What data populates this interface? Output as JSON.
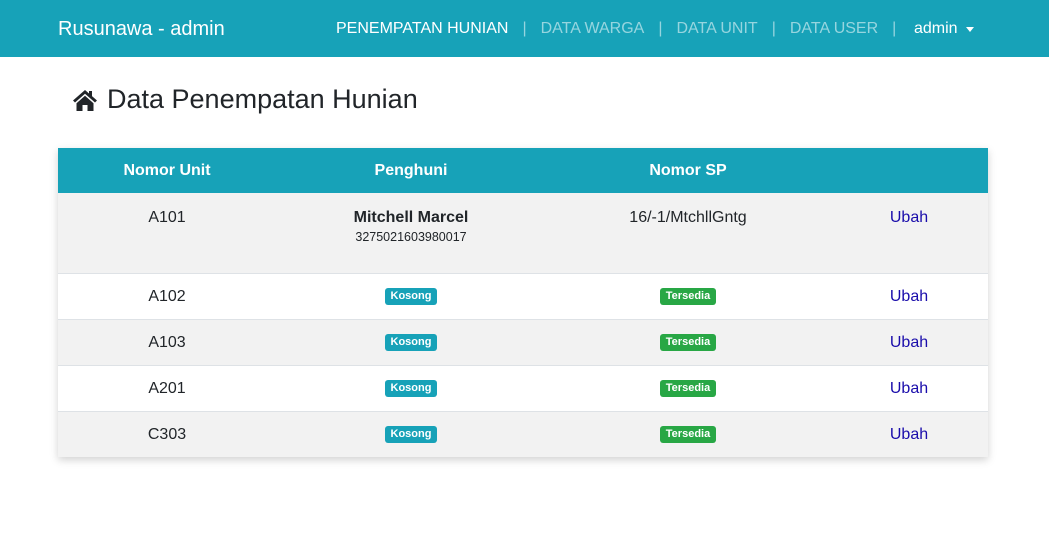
{
  "navbar": {
    "brand": "Rusunawa - admin",
    "links": [
      {
        "label": "PENEMPATAN HUNIAN",
        "active": true
      },
      {
        "label": "DATA WARGA",
        "active": false
      },
      {
        "label": "DATA UNIT",
        "active": false
      },
      {
        "label": "DATA USER",
        "active": false
      }
    ],
    "separator": "|",
    "user": "admin"
  },
  "page": {
    "icon": "home-icon",
    "title": "Data Penempatan Hunian"
  },
  "table": {
    "headers": [
      "Nomor Unit",
      "Penghuni",
      "Nomor SP",
      ""
    ],
    "rows": [
      {
        "unit": "A101",
        "occupant_name": "Mitchell Marcel",
        "occupant_nik": "3275021603980017",
        "sp": "16/-1/MtchllGntg",
        "action": "Ubah"
      },
      {
        "unit": "A102",
        "occupant_badge": "Kosong",
        "sp_badge": "Tersedia",
        "action": "Ubah"
      },
      {
        "unit": "A103",
        "occupant_badge": "Kosong",
        "sp_badge": "Tersedia",
        "action": "Ubah"
      },
      {
        "unit": "A201",
        "occupant_badge": "Kosong",
        "sp_badge": "Tersedia",
        "action": "Ubah"
      },
      {
        "unit": "C303",
        "occupant_badge": "Kosong",
        "sp_badge": "Tersedia",
        "action": "Ubah"
      }
    ]
  },
  "colors": {
    "primary": "#17a2b8",
    "success": "#28a745",
    "link": "#1a0dab",
    "stripe": "#f2f2f2"
  }
}
